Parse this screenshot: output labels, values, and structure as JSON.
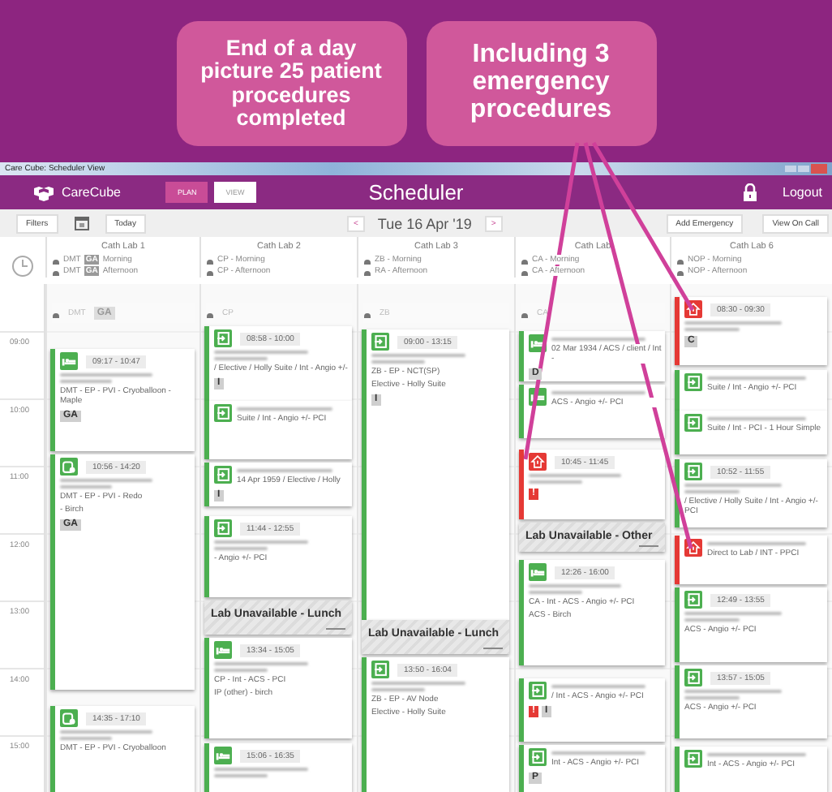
{
  "callouts": [
    {
      "text": "End of a day picture 25 patient procedures completed"
    },
    {
      "text": "Including 3 emergency procedures"
    }
  ],
  "window": {
    "title": "Care Cube: Scheduler View"
  },
  "header": {
    "logo": "CareCube",
    "modes": [
      {
        "label": "PLAN",
        "selected": true
      },
      {
        "label": "VIEW",
        "selected": false
      }
    ],
    "title": "Scheduler",
    "logout": "Logout"
  },
  "toolbar": {
    "filters": "Filters",
    "today": "Today",
    "prev": "<",
    "date": "Tue 16 Apr '19",
    "next": ">",
    "add_emergency": "Add Emergency",
    "view_on_call": "View On Call"
  },
  "times": [
    "09:00",
    "10:00",
    "11:00",
    "12:00",
    "13:00",
    "14:00",
    "15:00"
  ],
  "labs": [
    {
      "name": "Cath Lab 1",
      "staff": [
        {
          "text": "DMT",
          "badge": "GA",
          "session": "Morning"
        },
        {
          "text": "DMT",
          "badge": "GA",
          "session": "Afternoon"
        }
      ],
      "tags": [
        "DMT",
        "GA"
      ],
      "bookings": [
        {
          "kind": "bed",
          "emergency": false,
          "time": "09:17 - 10:47",
          "lines": [
            "DMT - EP - PVI - Cryoballoon - Maple"
          ],
          "badges": [
            {
              "text": "GA",
              "kind": "info"
            }
          ]
        },
        {
          "kind": "pod",
          "emergency": false,
          "time": "10:56 - 14:20",
          "lines": [
            "DMT - EP - PVI - Redo",
            "- Birch"
          ],
          "badges": [
            {
              "text": "GA",
              "kind": "info"
            }
          ]
        },
        {
          "kind": "pod",
          "emergency": false,
          "time": "14:35 - 17:10",
          "lines": [
            "DMT - EP - PVI - Cryoballoon"
          ]
        }
      ]
    },
    {
      "name": "Cath Lab 2",
      "staff": [
        {
          "text": "CP - Morning"
        },
        {
          "text": "CP - Afternoon"
        }
      ],
      "tags": [
        "CP"
      ],
      "bookings": [
        {
          "kind": "exit",
          "emergency": false,
          "time": "08:58 - 10:00",
          "lines": [
            "/ Elective / Holly Suite / Int - Angio +/-"
          ],
          "badges": [
            {
              "text": "I",
              "kind": "info"
            }
          ]
        },
        {
          "kind": "exit",
          "emergency": false,
          "lines": [
            "Suite / Int - Angio +/- PCI"
          ]
        },
        {
          "kind": "exit",
          "emergency": false,
          "lines": [
            "14 Apr 1959 / Elective / Holly"
          ],
          "badges": [
            {
              "text": "I",
              "kind": "info"
            }
          ]
        },
        {
          "kind": "exit",
          "emergency": false,
          "time": "11:44 - 12:55",
          "lines": [
            "- Angio +/- PCI"
          ]
        },
        {
          "kind": "unavailable",
          "text": "Lab Unavailable - Lunch"
        },
        {
          "kind": "bed",
          "emergency": false,
          "time": "13:34 - 15:05",
          "lines": [
            "CP - Int - ACS - PCI",
            "IP (other) - birch"
          ]
        },
        {
          "kind": "bed",
          "emergency": false,
          "time": "15:06 - 16:35"
        }
      ]
    },
    {
      "name": "Cath Lab 3",
      "staff": [
        {
          "text": "ZB - Morning"
        },
        {
          "text": "RA - Afternoon"
        }
      ],
      "tags": [
        "ZB"
      ],
      "bookings": [
        {
          "kind": "exit",
          "emergency": false,
          "time": "09:00 - 13:15",
          "lines": [
            "ZB - EP - NCT(SP)",
            "Elective - Holly Suite"
          ],
          "badges": [
            {
              "text": "I",
              "kind": "info"
            }
          ]
        },
        {
          "kind": "unavailable",
          "text": "Lab Unavailable - Lunch"
        },
        {
          "kind": "exit",
          "emergency": false,
          "time": "13:50 - 16:04",
          "lines": [
            "ZB - EP - AV Node",
            "Elective - Holly Suite"
          ]
        }
      ]
    },
    {
      "name": "Cath Lab",
      "staff": [
        {
          "text": "CA - Morning"
        },
        {
          "text": "CA - Afternoon"
        }
      ],
      "tags": [
        "CA"
      ],
      "bookings": [
        {
          "kind": "bed",
          "emergency": false,
          "lines": [
            "02 Mar 1934 / ACS / client / Int -"
          ],
          "badges": [
            {
              "text": "D",
              "kind": "info"
            }
          ]
        },
        {
          "kind": "bed",
          "emergency": false,
          "lines": [
            "ACS - Angio +/- PCI"
          ]
        },
        {
          "kind": "alert",
          "emergency": true,
          "time": "10:45 - 11:45",
          "badges": [
            {
              "text": "!",
              "kind": "alert"
            }
          ]
        },
        {
          "kind": "unavailable",
          "text": "Lab Unavailable - Other"
        },
        {
          "kind": "bed",
          "emergency": false,
          "time": "12:26 - 16:00",
          "lines": [
            "CA - Int - ACS - Angio +/- PCI",
            "ACS - Birch"
          ]
        },
        {
          "kind": "exit",
          "emergency": false,
          "lines": [
            "/ Int - ACS - Angio +/- PCI"
          ],
          "badges": [
            {
              "text": "!",
              "kind": "alert"
            },
            {
              "text": "I",
              "kind": "info"
            }
          ]
        },
        {
          "kind": "exit",
          "emergency": false,
          "lines": [
            "Int - ACS - Angio +/- PCI"
          ],
          "badges": [
            {
              "text": "P",
              "kind": "info"
            }
          ]
        }
      ]
    },
    {
      "name": "Cath Lab 6",
      "staff": [
        {
          "text": "NOP - Morning"
        },
        {
          "text": "NOP - Afternoon"
        }
      ],
      "bookings": [
        {
          "kind": "alert",
          "emergency": true,
          "time": "08:30 - 09:30",
          "badges": [
            {
              "text": "C",
              "kind": "info"
            }
          ]
        },
        {
          "kind": "exit",
          "emergency": false,
          "lines": [
            "Suite / Int - Angio +/- PCI"
          ]
        },
        {
          "kind": "exit",
          "emergency": false,
          "lines": [
            "Suite / Int - PCI - 1 Hour Simple"
          ]
        },
        {
          "kind": "exit",
          "emergency": false,
          "time": "10:52 - 11:55",
          "lines": [
            "/ Elective / Holly Suite / Int - Angio +/- PCI"
          ]
        },
        {
          "kind": "alert",
          "emergency": true,
          "lines": [
            "Direct to Lab / INT - PPCI"
          ]
        },
        {
          "kind": "exit",
          "emergency": false,
          "time": "12:49 - 13:55",
          "lines": [
            "ACS - Angio +/- PCI"
          ]
        },
        {
          "kind": "exit",
          "emergency": false,
          "time": "13:57 - 15:05",
          "lines": [
            "ACS - Angio +/- PCI"
          ]
        },
        {
          "kind": "exit",
          "emergency": false,
          "lines": [
            "Int - ACS - Angio +/- PCI"
          ]
        }
      ]
    }
  ]
}
